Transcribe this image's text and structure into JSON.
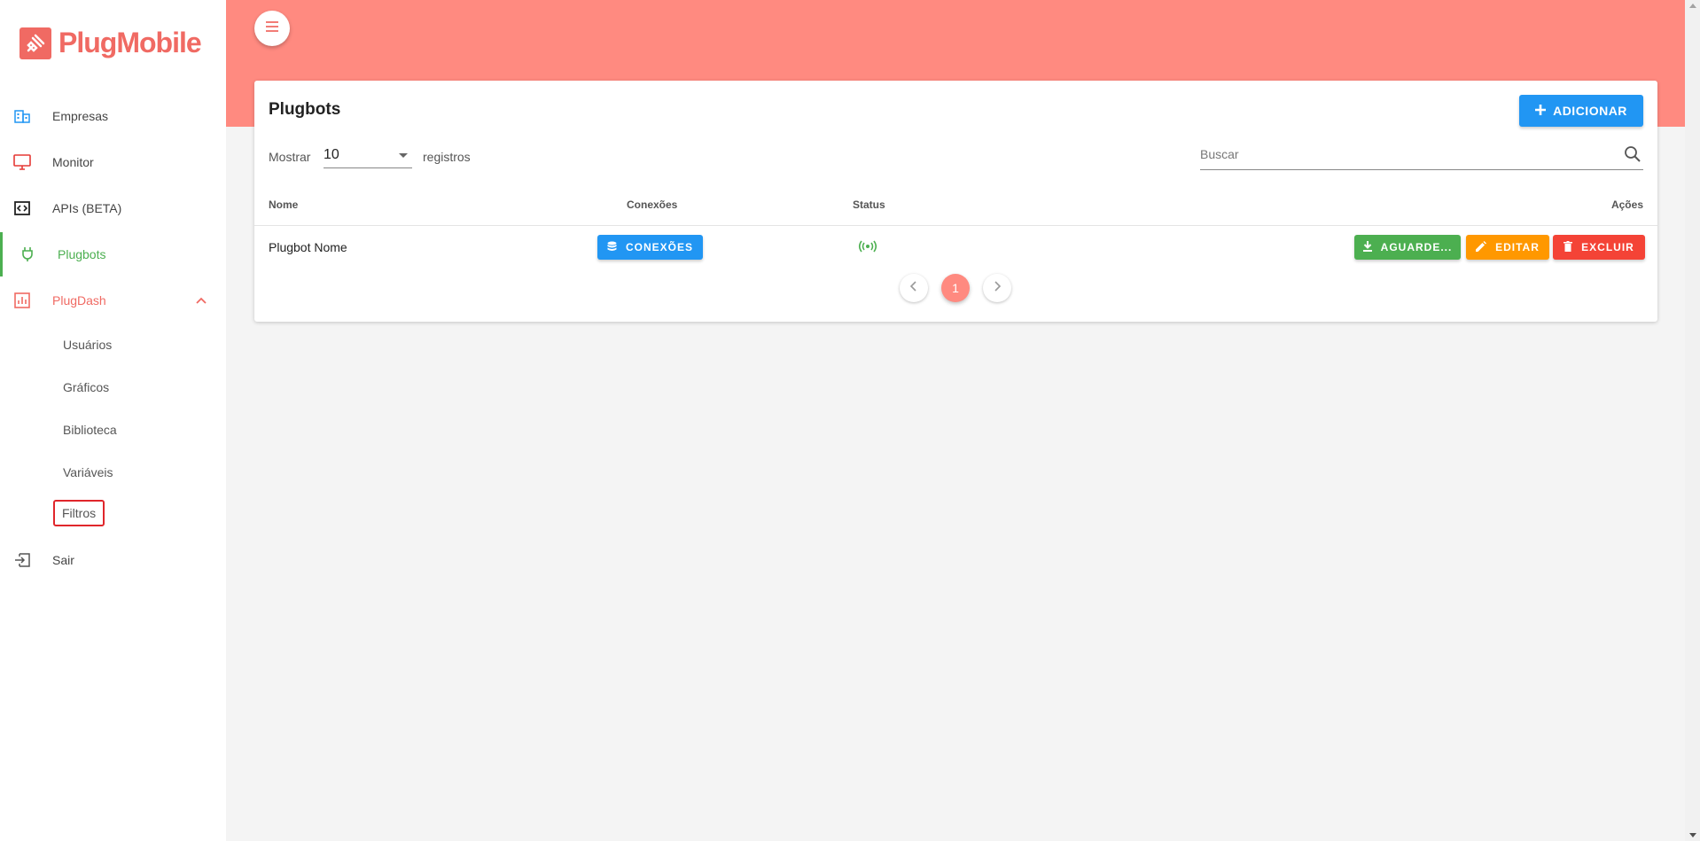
{
  "brand": {
    "name": "PlugMobile",
    "color": "#f06a63"
  },
  "sidebar": {
    "items": [
      {
        "label": "Empresas",
        "icon": "building-icon"
      },
      {
        "label": "Monitor",
        "icon": "monitor-icon"
      },
      {
        "label": "APIs (BETA)",
        "icon": "code-icon"
      },
      {
        "label": "Plugbots",
        "icon": "plug-icon",
        "active": true
      },
      {
        "label": "PlugDash",
        "icon": "chart-icon",
        "expanded": true
      },
      {
        "label": "Sair",
        "icon": "exit-icon"
      }
    ],
    "plugdash_sub": [
      {
        "label": "Usuários"
      },
      {
        "label": "Gráficos"
      },
      {
        "label": "Biblioteca"
      },
      {
        "label": "Variáveis"
      },
      {
        "label": "Filtros",
        "highlighted": true
      }
    ]
  },
  "header": {
    "menu_icon": "hamburger-icon",
    "color": "#ff8a80"
  },
  "card": {
    "title": "Plugbots",
    "add_button": "ADICIONAR",
    "show_label": "Mostrar",
    "page_size": "10",
    "records_label": "registros",
    "search_placeholder": "Buscar",
    "columns": {
      "name": "Nome",
      "connections": "Conexões",
      "status": "Status",
      "actions": "Ações"
    },
    "rows": [
      {
        "name": "Plugbot Nome",
        "connections_button": "CONEXÕES",
        "status_icon": "broadcast-icon",
        "status_color": "#4caf50",
        "actions": {
          "download": "AGUARDE...",
          "edit": "EDITAR",
          "delete": "EXCLUIR"
        }
      }
    ],
    "pagination": {
      "current": "1"
    }
  },
  "colors": {
    "primary": "#2196f3",
    "success": "#4caf50",
    "warning": "#ff9800",
    "danger": "#f44336"
  }
}
